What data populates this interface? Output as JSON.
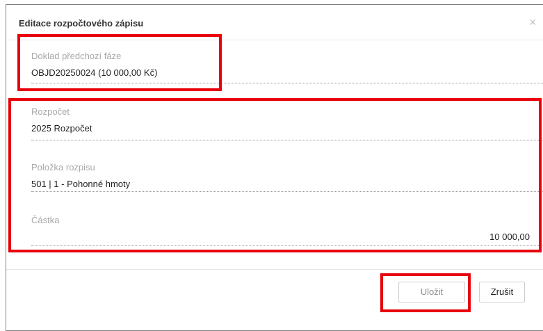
{
  "dialog": {
    "title": "Editace rozpočtového zápisu",
    "close_symbol": "×"
  },
  "fields": {
    "prior_document": {
      "label": "Doklad předchozí fáze",
      "value": "OBJD20250024 (10 000,00 Kč)"
    },
    "budget": {
      "label": "Rozpočet",
      "value": "2025 Rozpočet"
    },
    "budget_item": {
      "label": "Položka rozpisu",
      "value": "501 | 1 - Pohonné hmoty"
    },
    "amount": {
      "label": "Částka",
      "value": "10 000,00"
    }
  },
  "buttons": {
    "save_label": "Uložit",
    "cancel_label": "Zrušit"
  },
  "colors": {
    "highlight": "#e8000b",
    "label": "#a8a8a8",
    "text": "#222222"
  }
}
